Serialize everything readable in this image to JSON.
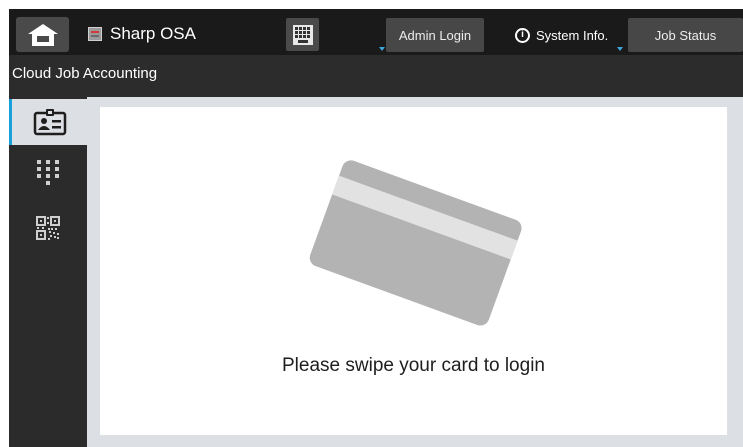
{
  "topbar": {
    "home_icon": "home-icon",
    "app_name": "Sharp OSA",
    "keyboard_icon": "keyboard-icon",
    "admin_login_label": "Admin Login",
    "system_info_label": "System Info.",
    "job_status_label": "Job Status"
  },
  "header": {
    "title": "Cloud Job Accounting"
  },
  "sidebar": {
    "items": [
      {
        "name": "id-card-login",
        "icon": "id-card-icon",
        "selected": true
      },
      {
        "name": "keypad-login",
        "icon": "keypad-icon",
        "selected": false
      },
      {
        "name": "qr-code-login",
        "icon": "qr-code-icon",
        "selected": false
      }
    ]
  },
  "main": {
    "message": "Please swipe your card to login",
    "illustration": "card-icon"
  },
  "colors": {
    "accent": "#1aa0d8",
    "topbar_bg": "#1a1a1a",
    "content_bg": "#dcdfe3"
  }
}
